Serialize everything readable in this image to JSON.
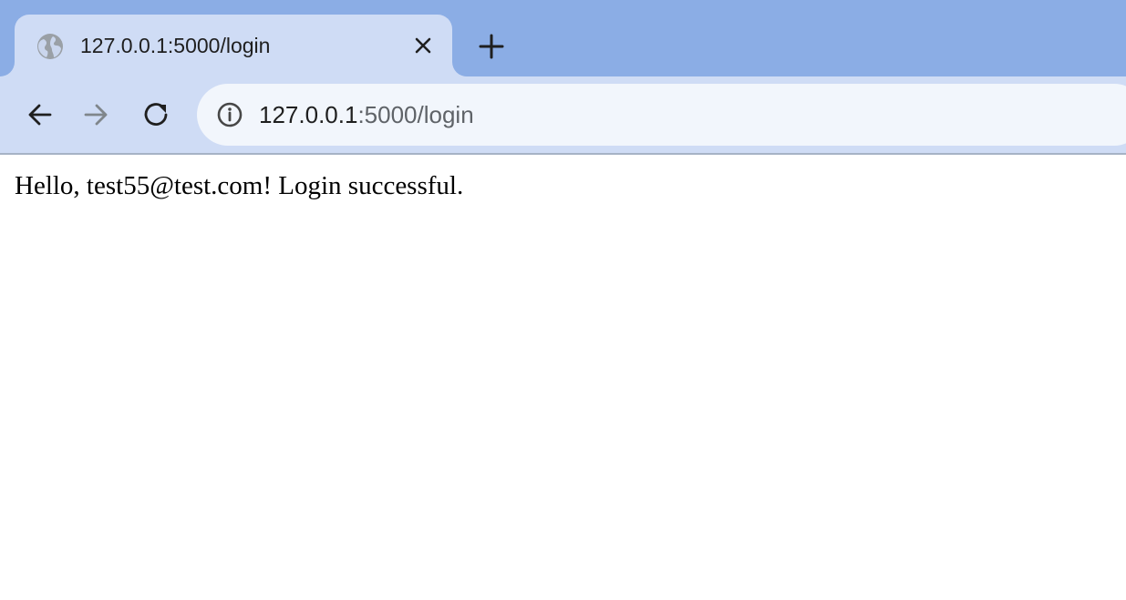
{
  "browser": {
    "tab": {
      "title": "127.0.0.1:5000/login",
      "favicon": "globe-icon"
    },
    "address_bar": {
      "host": "127.0.0.1",
      "path": ":5000/login"
    },
    "colors": {
      "tabstrip": "#8badE5",
      "active_tab": "#cfdcf5",
      "omnibox": "#f2f6fc"
    }
  },
  "page": {
    "message": "Hello, test55@test.com! Login successful."
  }
}
